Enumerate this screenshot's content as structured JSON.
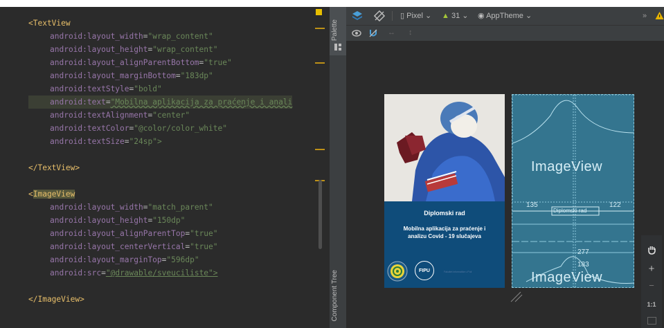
{
  "editor": {
    "textview_open": "<TextView",
    "textview_close": "</TextView>",
    "imageview_tag": "ImageView",
    "imageview_close": "</ImageView>",
    "ns": "android:",
    "textview_attrs": [
      {
        "name": "layout_width",
        "value": "\"wrap_content\""
      },
      {
        "name": "layout_height",
        "value": "\"wrap_content\""
      },
      {
        "name": "layout_alignParentBottom",
        "value": "\"true\""
      },
      {
        "name": "layout_marginBottom",
        "value": "\"183dp\""
      },
      {
        "name": "textStyle",
        "value": "\"bold\""
      },
      {
        "name": "text",
        "value": "\"Mobilna aplikacija za praćenje i anali"
      },
      {
        "name": "textAlignment",
        "value": "\"center\""
      },
      {
        "name": "textColor",
        "value": "\"@color/color_white\""
      },
      {
        "name": "textSize",
        "value": "\"24sp\">"
      }
    ],
    "imageview_attrs": [
      {
        "name": "layout_width",
        "value": "\"match_parent\""
      },
      {
        "name": "layout_height",
        "value": "\"150dp\""
      },
      {
        "name": "layout_alignParentTop",
        "value": "\"true\""
      },
      {
        "name": "layout_centerVertical",
        "value": "\"true\""
      },
      {
        "name": "layout_marginTop",
        "value": "\"596dp\""
      },
      {
        "name": "src",
        "value": "\"@drawable/sveuciliste\">"
      }
    ]
  },
  "side_panel": {
    "palette_label": "Palette",
    "component_tree_label": "Component Tree"
  },
  "toolbar": {
    "device": "Pixel",
    "api_level": "31",
    "theme": "AppTheme",
    "overflow": "»"
  },
  "preview": {
    "banner_title": "Diplomski rad",
    "banner_subtitle_line1": "Mobilna aplikacija za praćenje i",
    "banner_subtitle_line2": "analizu Covid - 19 slučajeva",
    "fipu_logo": "FIPU",
    "footer_text": "Fakultet informatike u Puli"
  },
  "blueprint": {
    "top_label": "ImageView",
    "bottom_label": "ImageView",
    "margin_left": "135",
    "margin_right": "122",
    "textview_label": "Diplomski rad",
    "margin_top_value": "277",
    "margin_bottom_value": "183"
  },
  "right_tools": {
    "zoom_in": "+",
    "zoom_out": "−",
    "actual_size": "1:1"
  },
  "colors": {
    "editor_bg": "#2b2b2b",
    "tag": "#e8bf6a",
    "attr_namespace": "#9876aa",
    "string_value": "#6a8759",
    "blueprint": "#34758f",
    "banner": "#0f4c7a"
  }
}
